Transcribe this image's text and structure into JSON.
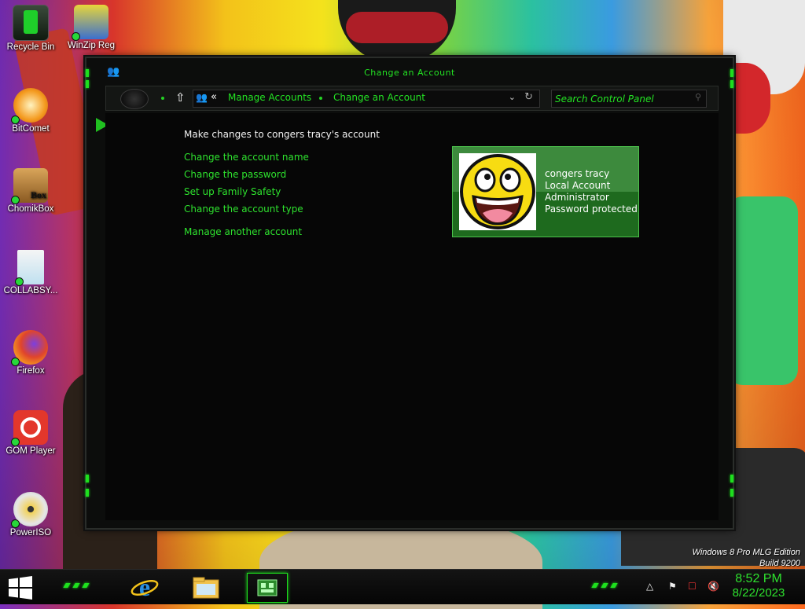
{
  "desktop": {
    "icons": [
      {
        "label": "Recycle Bin"
      },
      {
        "label": "WinZip Reg"
      },
      {
        "label": "BitComet"
      },
      {
        "label": "ChomikBox"
      },
      {
        "label": "COLLABSY..."
      },
      {
        "label": "Firefox"
      },
      {
        "label": "GOM Player"
      },
      {
        "label": "PowerISO"
      }
    ],
    "watermark_line1": "Windows 8 Pro MLG Edition",
    "watermark_line2": "Build 9200"
  },
  "window": {
    "title": "Change an Account",
    "breadcrumb_separator": "«",
    "breadcrumb": [
      {
        "label": "Manage Accounts"
      },
      {
        "label": "Change an Account"
      }
    ],
    "search_placeholder": "Search Control Panel"
  },
  "content": {
    "heading": "Make changes to congers tracy's account",
    "tasks": [
      {
        "label": "Change the account name"
      },
      {
        "label": "Change the password"
      },
      {
        "label": "Set up Family Safety"
      },
      {
        "label": "Change the account type"
      },
      {
        "label": "Manage another account"
      }
    ],
    "account": {
      "name": "congers tracy",
      "type": "Local Account",
      "role": "Administrator",
      "password_status": "Password protected"
    }
  },
  "taskbar": {
    "time": "8:52 PM",
    "date": "8/22/2023",
    "apps": [
      "internet-explorer-icon",
      "file-explorer-icon",
      "control-panel-icon"
    ]
  },
  "colors": {
    "accent": "#23e223",
    "window_bg": "#060606",
    "card_top": "#3d8a3d",
    "card_bottom": "#1e6a1e"
  }
}
